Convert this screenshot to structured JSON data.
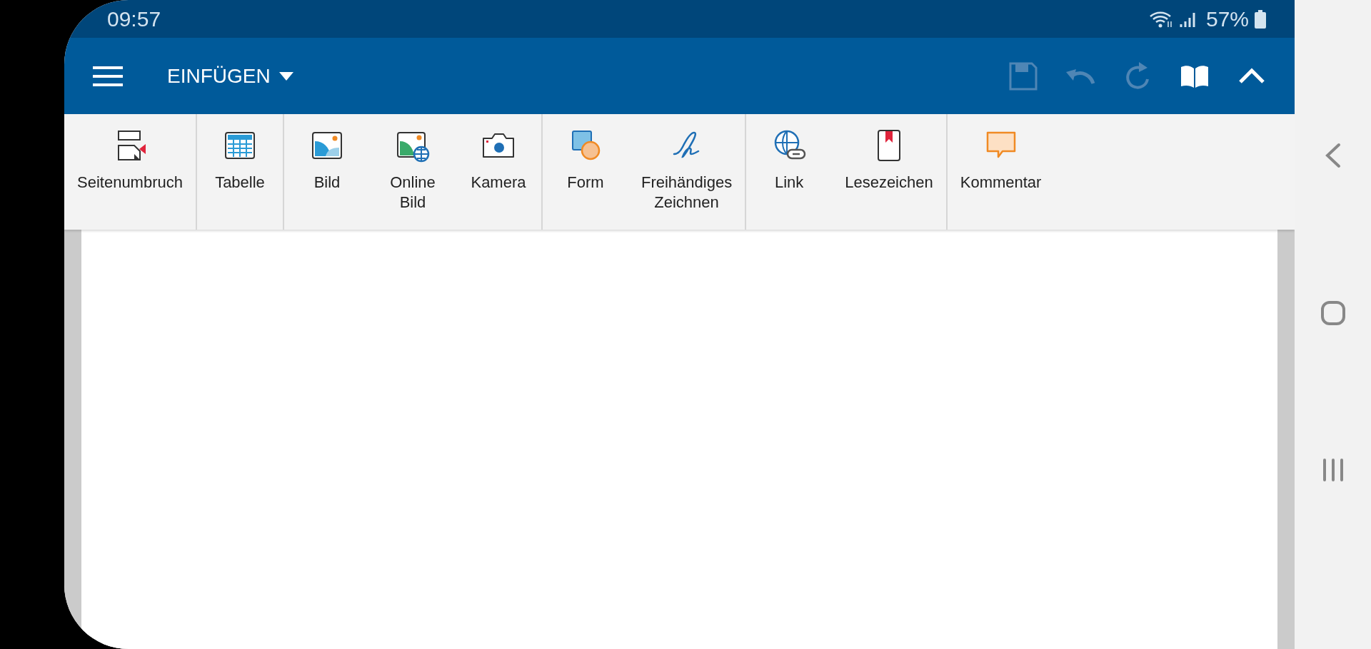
{
  "status_bar": {
    "time": "09:57",
    "battery": "57%"
  },
  "app_bar": {
    "title": "EINFÜGEN",
    "actions": [
      {
        "kind": "save",
        "disabled": true
      },
      {
        "kind": "undo",
        "disabled": true
      },
      {
        "kind": "redo",
        "disabled": true
      },
      {
        "kind": "read",
        "disabled": false
      },
      {
        "kind": "collapse",
        "disabled": false
      }
    ]
  },
  "ribbon": {
    "groups": [
      {
        "items": [
          {
            "kind": "pagebreak",
            "label": "Seitenumbruch"
          }
        ]
      },
      {
        "items": [
          {
            "kind": "table",
            "label": "Tabelle"
          }
        ]
      },
      {
        "items": [
          {
            "kind": "picture",
            "label": "Bild"
          },
          {
            "kind": "online",
            "label": "Online\nBild"
          },
          {
            "kind": "camera",
            "label": "Kamera"
          }
        ]
      },
      {
        "items": [
          {
            "kind": "shape",
            "label": "Form"
          },
          {
            "kind": "draw",
            "label": "Freihändiges\nZeichnen"
          }
        ]
      },
      {
        "items": [
          {
            "kind": "link",
            "label": "Link"
          },
          {
            "kind": "bookmark",
            "label": "Lesezeichen"
          }
        ]
      },
      {
        "items": [
          {
            "kind": "comment",
            "label": "Kommentar"
          }
        ]
      }
    ]
  }
}
